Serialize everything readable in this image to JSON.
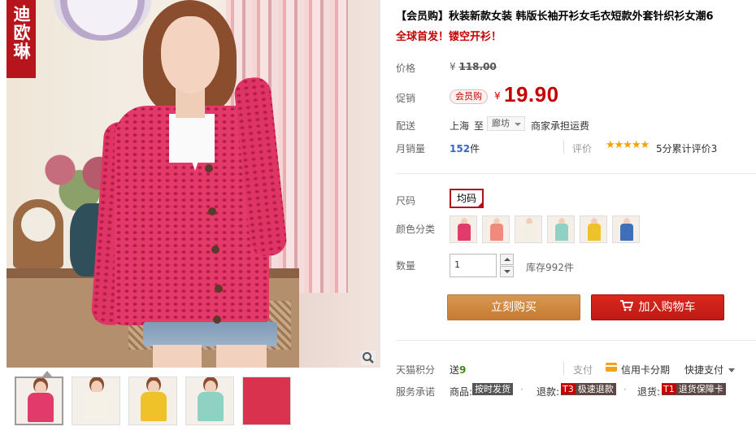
{
  "brand": {
    "logo_text": "迪欧琳"
  },
  "gallery": {
    "thumbnail_count": 5,
    "active_index": 0,
    "thumbnails": [
      {
        "name": "rose",
        "color": "#e23a6b"
      },
      {
        "name": "white",
        "color": "#f5f1e6"
      },
      {
        "name": "yellow",
        "color": "#f0c22a"
      },
      {
        "name": "mint",
        "color": "#8fd1c3"
      },
      {
        "name": "detail",
        "color": "#d8324f"
      }
    ]
  },
  "product": {
    "title": "【会员购】秋装新款女装 韩版长袖开衫女毛衣短款外套针织衫女潮6",
    "subtitle": "全球首发！镂空开衫！"
  },
  "price": {
    "label": "价格",
    "currency": "¥",
    "original": "118.00"
  },
  "promo": {
    "label": "促销",
    "badge": "会员购",
    "currency": "¥",
    "price": "19.90"
  },
  "shipping": {
    "label": "配送",
    "from": "上海",
    "to_word": "至",
    "destination": "廊坊",
    "note": "商家承担运费"
  },
  "sales": {
    "label": "月销量",
    "count": "152",
    "unit": "件"
  },
  "rating": {
    "label": "评价",
    "stars": 5,
    "stars_glyph": "★★★★★",
    "text": "5分累计评价3"
  },
  "size": {
    "label": "尺码",
    "selected": "均码"
  },
  "color_category": {
    "label": "颜色分类",
    "options": [
      {
        "name": "rose",
        "color": "#e23a6b"
      },
      {
        "name": "coral",
        "color": "#f08a7a"
      },
      {
        "name": "white",
        "color": "#f3efe2"
      },
      {
        "name": "mint",
        "color": "#8fd1c3"
      },
      {
        "name": "yellow",
        "color": "#f0c22a"
      },
      {
        "name": "blue",
        "color": "#3f6fb8"
      }
    ]
  },
  "quantity": {
    "label": "数量",
    "value": "1",
    "stock": "库存992件"
  },
  "actions": {
    "buy_now": "立刻购买",
    "add_to_cart": "加入购物车"
  },
  "tmall_points": {
    "label": "天猫积分",
    "prefix": "送",
    "value": "9"
  },
  "payment": {
    "label": "支付",
    "credit": "信用卡分期",
    "quick": "快捷支付"
  },
  "service": {
    "label": "服务承诺",
    "goods_label": "商品:",
    "goods_tag": "按时发货",
    "speed_label": "退款:",
    "speed_code": "T3",
    "speed_tag": "极速退款",
    "refund_label": "退货:",
    "refund_code": "T1",
    "refund_tag": "退货保障卡"
  },
  "colors": {
    "accent_red": "#c40000",
    "buy_now_orange": "#c67a33",
    "cart_red": "#be1a13",
    "star_gold": "#f5a100"
  }
}
